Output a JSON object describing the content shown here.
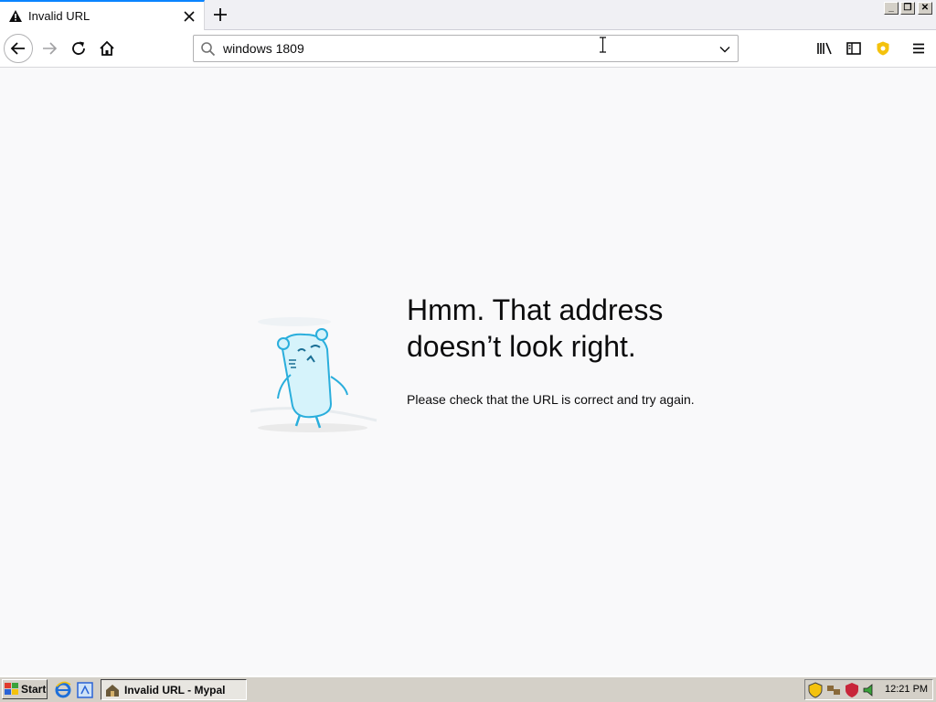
{
  "tab": {
    "title": "Invalid URL"
  },
  "window_controls": {
    "minimize": "_",
    "restore": "❐",
    "close": "✕"
  },
  "urlbar": {
    "value": "windows 1809"
  },
  "error": {
    "heading_line1": "Hmm. That address",
    "heading_line2": "doesn’t look right.",
    "description": "Please check that the URL is correct and try again."
  },
  "taskbar": {
    "start_label": "Start",
    "task_label": "Invalid URL - Mypal",
    "clock": "12:21 PM"
  },
  "icons": [
    "warning-icon",
    "close-tab-icon",
    "new-tab-icon",
    "back-icon",
    "forward-icon",
    "reload-icon",
    "home-icon",
    "search-icon",
    "dropdown-icon",
    "library-icon",
    "sidebar-icon",
    "shield-icon",
    "menu-icon"
  ],
  "colors": {
    "accent": "#0a84ff",
    "page_bg": "#f9f9fa",
    "taskbar_bg": "#d4d0c8"
  }
}
